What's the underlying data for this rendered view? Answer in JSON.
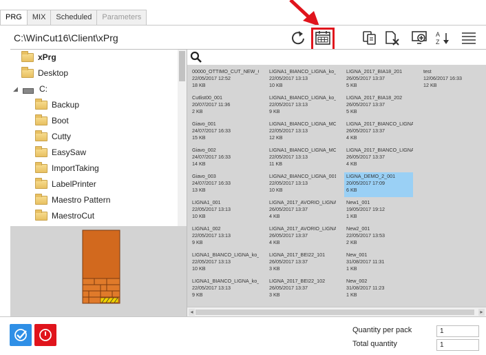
{
  "tabs": [
    {
      "label": "PRG",
      "active": true
    },
    {
      "label": "MIX",
      "active": false
    },
    {
      "label": "Scheduled",
      "active": false
    },
    {
      "label": "Parameters",
      "active": false,
      "disabled": true
    }
  ],
  "path": "C:\\WinCut16\\Client\\xPrg",
  "toolbar": {
    "icons": [
      "refresh-icon",
      "calendar-icon",
      "copy-icon",
      "delete-file-icon",
      "add-screen-icon",
      "sort-az-icon",
      "list-view-icon"
    ],
    "highlight_color": "#e0141c"
  },
  "tree": {
    "items": [
      {
        "label": "xPrg",
        "level": 0,
        "type": "folder",
        "selected": true
      },
      {
        "label": "Desktop",
        "level": 0,
        "type": "folder"
      },
      {
        "label": "C:",
        "level": 0,
        "type": "drive"
      },
      {
        "label": "Backup",
        "level": 1,
        "type": "folder"
      },
      {
        "label": "Boot",
        "level": 1,
        "type": "folder"
      },
      {
        "label": "Cutty",
        "level": 1,
        "type": "folder"
      },
      {
        "label": "EasySaw",
        "level": 1,
        "type": "folder"
      },
      {
        "label": "ImportTaking",
        "level": 1,
        "type": "folder"
      },
      {
        "label": "LabelPrinter",
        "level": 1,
        "type": "folder"
      },
      {
        "label": "Maestro Pattern",
        "level": 1,
        "type": "folder"
      },
      {
        "label": "MaestroCut",
        "level": 1,
        "type": "folder"
      }
    ]
  },
  "files": {
    "columns": [
      [
        {
          "name": "00000_OTTIMO_CUT_NEW_C",
          "date": "22/05/2017 12:52",
          "size": "18 KB"
        },
        {
          "name": "Cutlist00_001",
          "date": "20/07/2017 11:36",
          "size": "2 KB"
        },
        {
          "name": "Giavo_001",
          "date": "24/07/2017 16:33",
          "size": "15 KB"
        },
        {
          "name": "Giavo_002",
          "date": "24/07/2017 16:33",
          "size": "14 KB"
        },
        {
          "name": "Giavo_003",
          "date": "24/07/2017 16:33",
          "size": "13 KB"
        },
        {
          "name": "LIGNA1_001",
          "date": "22/05/2017 13:13",
          "size": "10 KB"
        },
        {
          "name": "LIGNA1_002",
          "date": "22/05/2017 13:13",
          "size": "9 KB"
        },
        {
          "name": "LIGNA1_BIANCO_LIGNA_ko_",
          "date": "22/05/2017 13:13",
          "size": "10 KB"
        },
        {
          "name": "LIGNA1_BIANCO_LIGNA_ko_",
          "date": "22/05/2017 13:13",
          "size": "9 KB"
        }
      ],
      [
        {
          "name": "LIGNA1_BIANCO_LIGNA_ko_",
          "date": "22/05/2017 13:13",
          "size": "10 KB"
        },
        {
          "name": "LIGNA1_BIANCO_LIGNA_ko_",
          "date": "22/05/2017 13:13",
          "size": "9 KB"
        },
        {
          "name": "LIGNA1_BIANCO_LIGNA_MC",
          "date": "22/05/2017 13:13",
          "size": "12 KB"
        },
        {
          "name": "LIGNA1_BIANCO_LIGNA_MC",
          "date": "22/05/2017 13:13",
          "size": "11 KB"
        },
        {
          "name": "LIGNA2_BIANCO_LIGNA_001",
          "date": "22/05/2017 13:13",
          "size": "10 KB"
        },
        {
          "name": "LIGNA_2017_AVORIO_LIGNA",
          "date": "26/05/2017 13:37",
          "size": "4 KB"
        },
        {
          "name": "LIGNA_2017_AVORIO_LIGNA",
          "date": "26/05/2017 13:37",
          "size": "4 KB"
        },
        {
          "name": "LIGNA_2017_BEI22_101",
          "date": "26/05/2017 13:37",
          "size": "3 KB"
        },
        {
          "name": "LIGNA_2017_BEI22_102",
          "date": "26/05/2017 13:37",
          "size": "3 KB"
        }
      ],
      [
        {
          "name": "LIGNA_2017_BIA18_201",
          "date": "26/05/2017 13:37",
          "size": "5 KB"
        },
        {
          "name": "LIGNA_2017_BIA18_202",
          "date": "26/05/2017 13:37",
          "size": "5 KB"
        },
        {
          "name": "LIGNA_2017_BIANCO_LIGNA",
          "date": "26/05/2017 13:37",
          "size": "4 KB"
        },
        {
          "name": "LIGNA_2017_BIANCO_LIGNA",
          "date": "26/05/2017 13:37",
          "size": "4 KB"
        },
        {
          "name": "LIGNA_DEMO_2_001",
          "date": "20/05/2017 17:09",
          "size": "6 KB",
          "selected": true
        },
        {
          "name": "New1_001",
          "date": "19/05/2017 19:12",
          "size": "1 KB"
        },
        {
          "name": "New2_001",
          "date": "22/05/2017 13:53",
          "size": "2 KB"
        },
        {
          "name": "New_001",
          "date": "31/08/2017 11:31",
          "size": "1 KB"
        },
        {
          "name": "New_002",
          "date": "31/08/2017 11:23",
          "size": "1 KB"
        }
      ],
      [
        {
          "name": "test",
          "date": "12/06/2017 16:33",
          "size": "12 KB"
        }
      ]
    ],
    "selected_color": "#9ad0f5"
  },
  "bottom": {
    "confirm_color": "#2f8fe6",
    "cancel_color": "#e0141c",
    "quantity_per_pack_label": "Quantity per pack",
    "quantity_per_pack_value": "1",
    "total_quantity_label": "Total quantity",
    "total_quantity_value": "1"
  }
}
